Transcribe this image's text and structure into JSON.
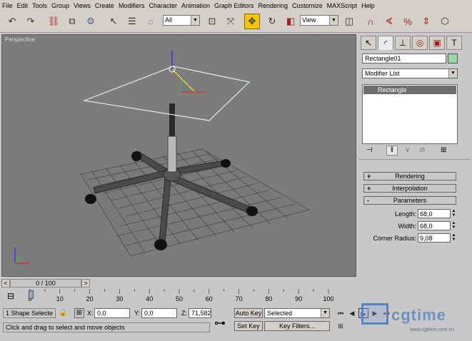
{
  "menu": [
    "File",
    "Edit",
    "Tools",
    "Group",
    "Views",
    "Create",
    "Modifiers",
    "Character",
    "Animation",
    "Graph Editors",
    "Rendering",
    "Customize",
    "MAXScript",
    "Help"
  ],
  "toolbar": {
    "selection_filter": "All",
    "ref_coord": "View"
  },
  "viewport": {
    "label": "Perspective"
  },
  "cmdpanel": {
    "object_name": "Rectangle01",
    "object_color": "#9ad7a7",
    "modifier_list": "Modifier List",
    "stack_item": "Rectangle",
    "rollouts": {
      "rendering": {
        "sign": "+",
        "label": "Rendering"
      },
      "interpolation": {
        "sign": "+",
        "label": "Interpolation"
      },
      "parameters": {
        "sign": "-",
        "label": "Parameters"
      }
    },
    "params": {
      "length": {
        "label": "Length:",
        "value": "68,0"
      },
      "width": {
        "label": "Width:",
        "value": "68,0"
      },
      "corner": {
        "label": "Corner Radius:",
        "value": "9,08"
      }
    }
  },
  "timeline": {
    "slider_label": "0 / 100",
    "prev": "<",
    "next": ">",
    "ticks": [
      "0",
      "10",
      "20",
      "30",
      "40",
      "50",
      "60",
      "70",
      "80",
      "90",
      "100"
    ]
  },
  "status": {
    "selection_count": "1 Shape Selecte",
    "x_label": "X:",
    "x_value": "0,0",
    "y_label": "Y:",
    "y_value": "0,0",
    "z_label": "Z:",
    "z_value": "71,582",
    "auto_key": "Auto Key",
    "set_key": "Set Key",
    "key_mode": "Selected",
    "key_filters": "Key Filters...",
    "prompt": "Click and drag to select and move objects",
    "watermark": "cgtime",
    "watermark_url": "www.cgtime.com.cn"
  }
}
